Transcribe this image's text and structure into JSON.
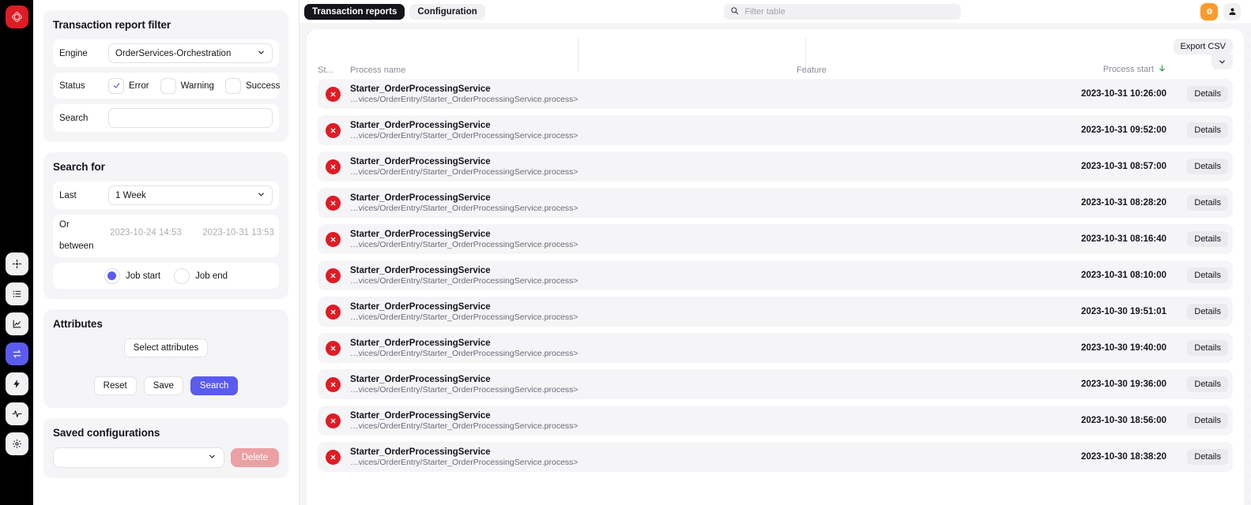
{
  "brand": {
    "logo_name": "app-logo",
    "accent": "#5b5bf0",
    "error_color": "#e01b24",
    "warn_color": "#fa9b2e"
  },
  "rail": {
    "items": [
      {
        "icon": "move-icon",
        "active": false
      },
      {
        "icon": "list-icon",
        "active": false
      },
      {
        "icon": "chart-icon",
        "active": false
      },
      {
        "icon": "transfer-icon",
        "active": true
      },
      {
        "icon": "lightning-icon",
        "active": false
      },
      {
        "icon": "pulse-icon",
        "active": false
      },
      {
        "icon": "gear-icon",
        "active": false
      }
    ]
  },
  "filter_panel": {
    "title": "Transaction report filter",
    "engine_label": "Engine",
    "engine_value": "OrderServices-Orchestration",
    "status_label": "Status",
    "status_options": [
      {
        "label": "Error",
        "checked": true
      },
      {
        "label": "Warning",
        "checked": false
      },
      {
        "label": "Success",
        "checked": false
      }
    ],
    "search_label": "Search",
    "search_value": "",
    "search_placeholder": ""
  },
  "search_for": {
    "title": "Search for",
    "last_label": "Last",
    "last_value": "1 Week",
    "or_label": "Or",
    "between_label": "between",
    "date_from": "2023-10-24 14:53",
    "date_to": "2023-10-31 13:53",
    "job_start_label": "Job start",
    "job_end_label": "Job end",
    "job_selected": "Job start"
  },
  "attributes": {
    "title": "Attributes",
    "select_attributes_label": "Select attributes",
    "reset_label": "Reset",
    "save_label": "Save",
    "search_label": "Search"
  },
  "saved_configurations": {
    "title": "Saved configurations",
    "select_value": "",
    "delete_label": "Delete"
  },
  "topbar": {
    "tabs": [
      {
        "label": "Transaction reports",
        "active": true
      },
      {
        "label": "Configuration",
        "active": false
      }
    ],
    "filter_placeholder": "Filter table",
    "filter_value": "",
    "search_icon": "search-icon",
    "alert_icon": "alert-icon",
    "user_icon": "user-icon"
  },
  "table": {
    "export_label": "Export CSV",
    "columns": {
      "status": "St...",
      "process_name": "Process name",
      "feature": "Feature",
      "process_start": "Process start",
      "details": ""
    },
    "sort_column": "Process start",
    "sort_direction": "desc",
    "details_label": "Details",
    "rows": [
      {
        "status": "error",
        "name": "Starter_OrderProcessingService",
        "path": "…vices/OrderEntry/Starter_OrderProcessingService.process>",
        "feature": "",
        "start": "2023-10-31 10:26:00"
      },
      {
        "status": "error",
        "name": "Starter_OrderProcessingService",
        "path": "…vices/OrderEntry/Starter_OrderProcessingService.process>",
        "feature": "",
        "start": "2023-10-31 09:52:00"
      },
      {
        "status": "error",
        "name": "Starter_OrderProcessingService",
        "path": "…vices/OrderEntry/Starter_OrderProcessingService.process>",
        "feature": "",
        "start": "2023-10-31 08:57:00"
      },
      {
        "status": "error",
        "name": "Starter_OrderProcessingService",
        "path": "…vices/OrderEntry/Starter_OrderProcessingService.process>",
        "feature": "",
        "start": "2023-10-31 08:28:20"
      },
      {
        "status": "error",
        "name": "Starter_OrderProcessingService",
        "path": "…vices/OrderEntry/Starter_OrderProcessingService.process>",
        "feature": "",
        "start": "2023-10-31 08:16:40"
      },
      {
        "status": "error",
        "name": "Starter_OrderProcessingService",
        "path": "…vices/OrderEntry/Starter_OrderProcessingService.process>",
        "feature": "",
        "start": "2023-10-31 08:10:00"
      },
      {
        "status": "error",
        "name": "Starter_OrderProcessingService",
        "path": "…vices/OrderEntry/Starter_OrderProcessingService.process>",
        "feature": "",
        "start": "2023-10-30 19:51:01"
      },
      {
        "status": "error",
        "name": "Starter_OrderProcessingService",
        "path": "…vices/OrderEntry/Starter_OrderProcessingService.process>",
        "feature": "",
        "start": "2023-10-30 19:40:00"
      },
      {
        "status": "error",
        "name": "Starter_OrderProcessingService",
        "path": "…vices/OrderEntry/Starter_OrderProcessingService.process>",
        "feature": "",
        "start": "2023-10-30 19:36:00"
      },
      {
        "status": "error",
        "name": "Starter_OrderProcessingService",
        "path": "…vices/OrderEntry/Starter_OrderProcessingService.process>",
        "feature": "",
        "start": "2023-10-30 18:56:00"
      },
      {
        "status": "error",
        "name": "Starter_OrderProcessingService",
        "path": "…vices/OrderEntry/Starter_OrderProcessingService.process>",
        "feature": "",
        "start": "2023-10-30 18:38:20"
      }
    ]
  }
}
